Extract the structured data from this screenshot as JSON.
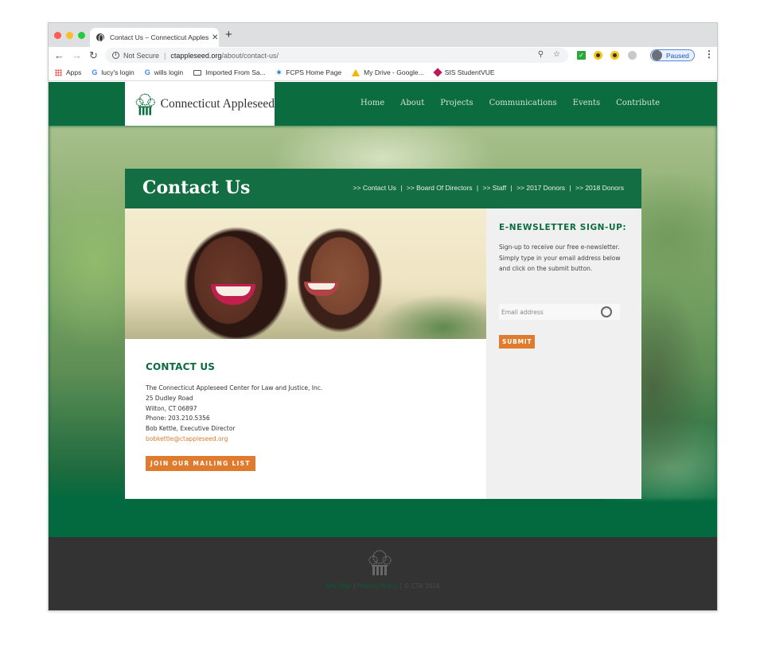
{
  "browser": {
    "tab_title": "Contact Us – Connecticut Appleseed",
    "tab_close": "✕",
    "new_tab": "+",
    "back": "←",
    "forward": "→",
    "reload": "↻",
    "security_label": "Not Secure",
    "url_host": "ctappleseed.org",
    "url_path": "/about/contact-us/",
    "zoom_icon": "⚲",
    "star_icon": "☆",
    "profile_status": "Paused",
    "menu": "⋮",
    "bookmarks": [
      {
        "label": "Apps",
        "icon": "apps-grid-icon"
      },
      {
        "label": "lucy's login",
        "icon": "google-icon"
      },
      {
        "label": "wills login",
        "icon": "google-icon"
      },
      {
        "label": "Imported From Sa...",
        "icon": "folder-icon"
      },
      {
        "label": "FCPS Home Page",
        "icon": "fcps-icon"
      },
      {
        "label": "My Drive - Google...",
        "icon": "google-drive-icon"
      },
      {
        "label": "SIS StudentVUE",
        "icon": "studentvue-icon"
      }
    ]
  },
  "site": {
    "logo_text": "Connecticut Appleseed",
    "nav": [
      "Home",
      "About",
      "Projects",
      "Communications",
      "Events",
      "Contribute"
    ],
    "page_title": "Contact Us",
    "subnav": [
      ">> Contact Us",
      ">> Board Of Directors",
      ">> Staff",
      ">> 2017 Donors",
      ">> 2018 Donors"
    ],
    "subnav_sep": "|",
    "contact": {
      "heading": "CONTACT US",
      "org": "The Connecticut Appleseed Center for Law and Justice, Inc.",
      "street": "25 Dudley Road",
      "city": "Wilton, CT 06897",
      "phone": "Phone: 203.210.5356",
      "director": "Bob Kettle, Executive Director",
      "email": "bobkettle@ctappleseed.org",
      "join_button": "JOIN OUR MAILING LIST"
    },
    "newsletter": {
      "heading": "E-NEWSLETTER SIGN-UP:",
      "description": "Sign-up to receive our free e-newsletter. Simply type in your email address below and click on the submit button.",
      "email_placeholder": "Email address",
      "submit": "SUBMIT"
    },
    "footer": {
      "site_map": "Site Map",
      "privacy": "Privacy Policy",
      "sep": " | ",
      "copyright": "© CTA 2016"
    },
    "colors": {
      "brand_green": "#0b6d3f",
      "accent_orange": "#e07b2e",
      "footer_bg": "#333333"
    }
  }
}
